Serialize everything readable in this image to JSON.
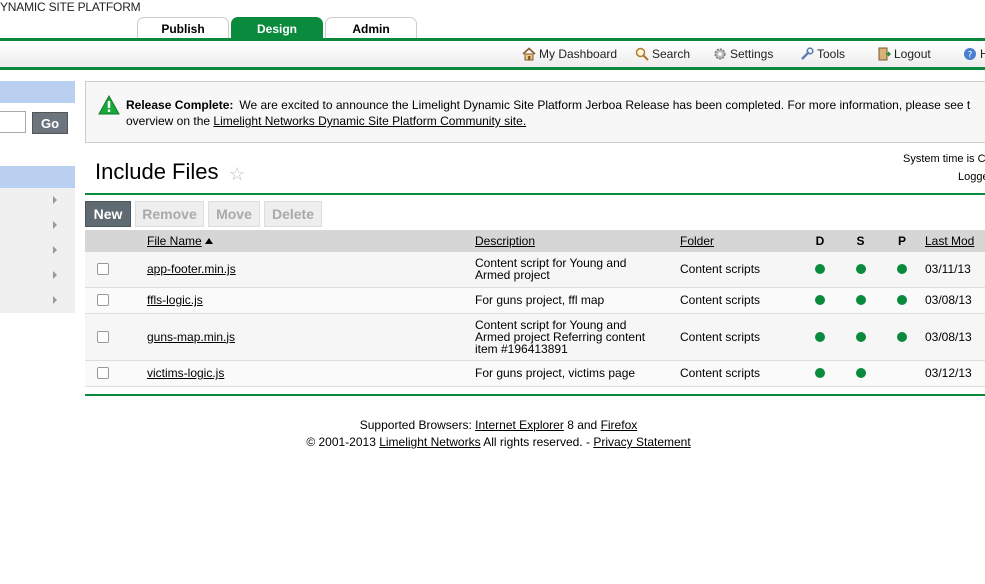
{
  "app": {
    "brand": "YNAMIC SITE PLATFORM"
  },
  "tabs": [
    {
      "label": "Publish"
    },
    {
      "label": "Design",
      "active": true
    },
    {
      "label": "Admin"
    }
  ],
  "toolbar": {
    "dashboard": "My Dashboard",
    "search": "Search",
    "settings": "Settings",
    "tools": "Tools",
    "logout": "Logout",
    "help": "H"
  },
  "sidebar": {
    "go_label": "Go",
    "search_value": ""
  },
  "notice": {
    "title": "Release Complete:",
    "text": "We are excited to announce the Limelight Dynamic Site Platform Jerboa Release has been completed. For more information, please see t",
    "line2_prefix": "overview on the ",
    "link": "Limelight Networks Dynamic Site Platform Community site."
  },
  "page": {
    "title": "Include Files",
    "system_time": "System time is C",
    "logged": "Logge"
  },
  "actions": {
    "new": "New",
    "remove": "Remove",
    "move": "Move",
    "delete": "Delete"
  },
  "table": {
    "headers": {
      "file_name": "File Name",
      "description": "Description",
      "folder": "Folder",
      "d": "D",
      "s": "S",
      "p": "P",
      "last_mod": "Last Mod"
    },
    "rows": [
      {
        "file": "app-footer.min.js",
        "description": "Content script for Young and Armed project",
        "folder": "Content scripts",
        "d": true,
        "s": true,
        "p": true,
        "last_mod": "03/11/13"
      },
      {
        "file": "ffls-logic.js",
        "description": "For guns project, ffl map",
        "folder": "Content scripts",
        "d": true,
        "s": true,
        "p": true,
        "last_mod": "03/08/13"
      },
      {
        "file": "guns-map.min.js",
        "description": "Content script for Young and Armed project Referring content item #196413891",
        "folder": "Content scripts",
        "d": true,
        "s": true,
        "p": true,
        "last_mod": "03/08/13"
      },
      {
        "file": "victims-logic.js",
        "description": "For guns project, victims page",
        "folder": "Content scripts",
        "d": true,
        "s": true,
        "p": false,
        "last_mod": "03/12/13"
      }
    ]
  },
  "footer": {
    "browsers_prefix": "Supported Browsers: ",
    "ie": "Internet Explorer",
    "ie_version": " 8 and ",
    "firefox": "Firefox",
    "copyright": "© 2001-2013 ",
    "company": "Limelight Networks",
    "rights": " All rights reserved. - ",
    "privacy": "Privacy Statement"
  },
  "colors": {
    "brand_green": "#0a8a3d",
    "side_blue": "#b9d0f0"
  }
}
